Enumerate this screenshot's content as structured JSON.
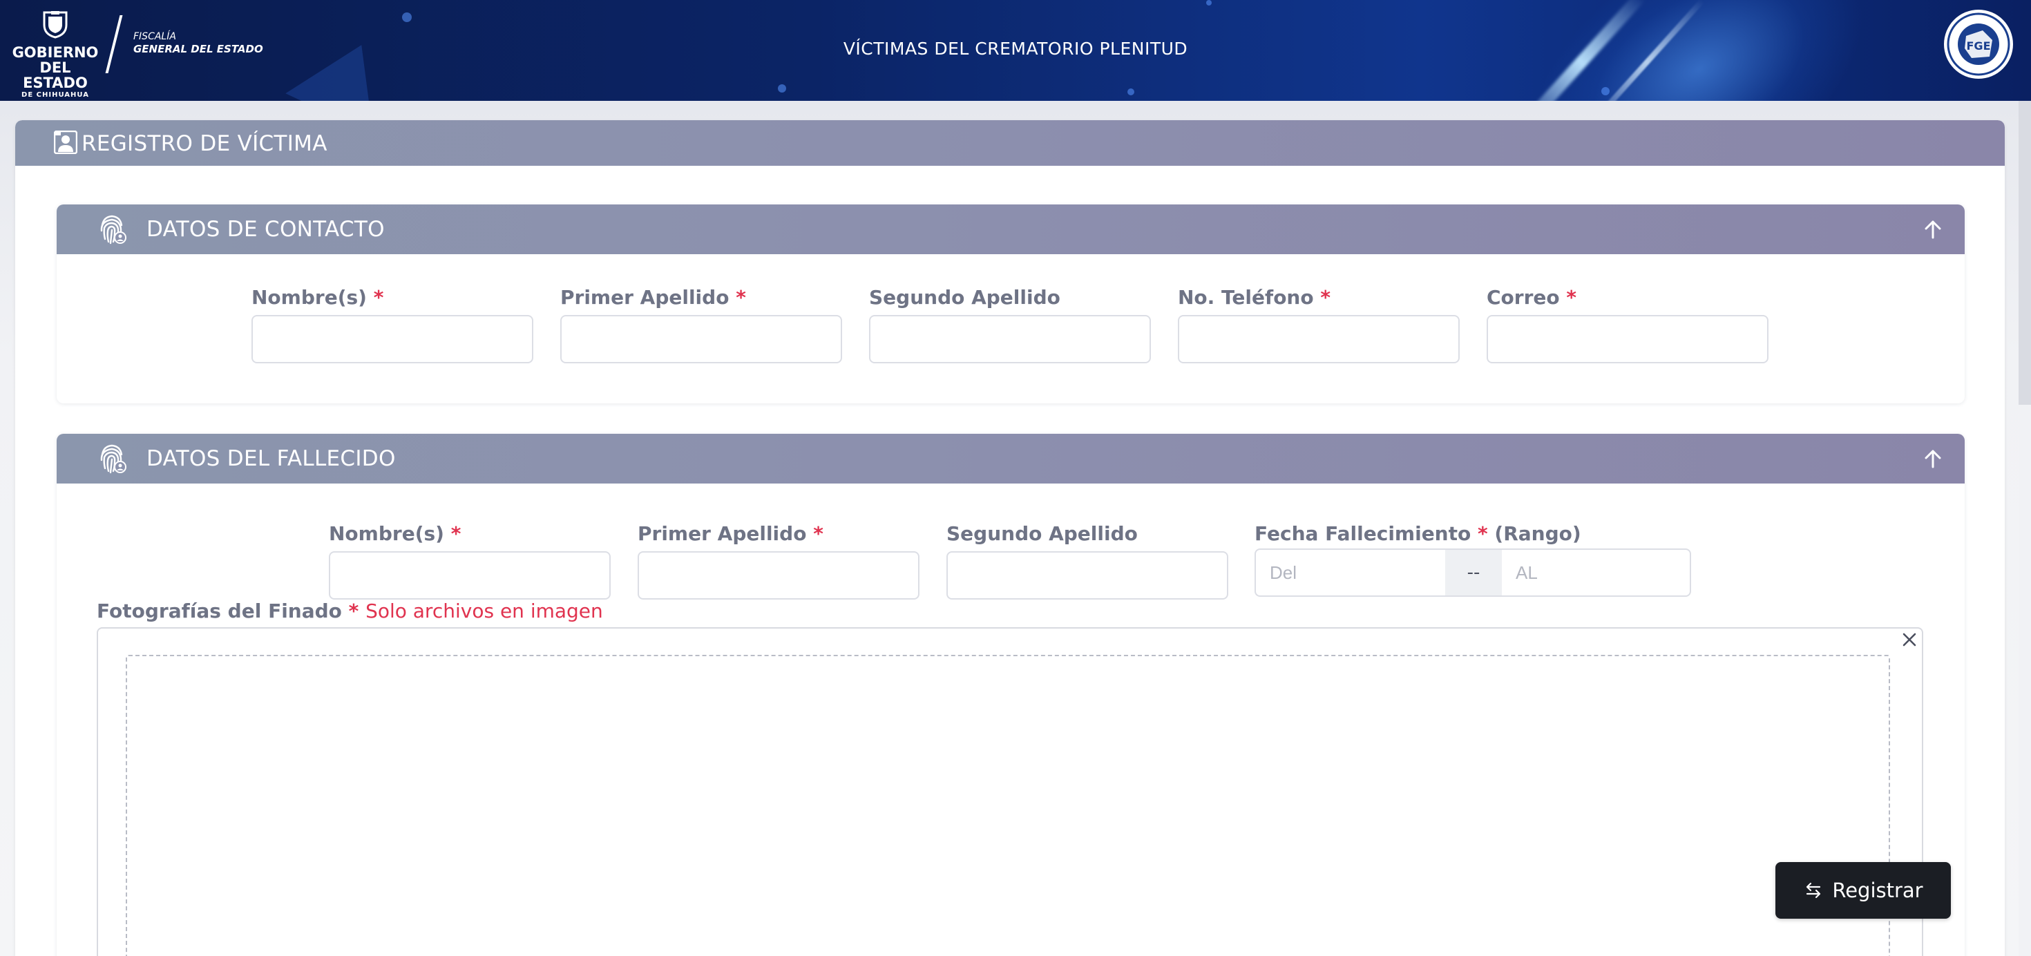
{
  "header": {
    "title": "VÍCTIMAS DEL CREMATORIO PLENITUD",
    "logo_gobierno": {
      "line1": "GOBIERNO",
      "line2": "DEL ESTADO",
      "line3": "DE CHIHUAHUA"
    },
    "logo_fiscalia": {
      "line1": "FISCALÍA",
      "line2": "GENERAL DEL ESTADO"
    },
    "seal_text": "FGE"
  },
  "main_card": {
    "title": "REGISTRO DE VÍCTIMA",
    "icon": "user-id-icon"
  },
  "contacto": {
    "title": "DATOS DE CONTACTO",
    "icon": "fingerprint-icon",
    "toggle_icon": "arrow-up-icon",
    "fields": [
      {
        "label": "Nombre(s)",
        "required": "*",
        "value": ""
      },
      {
        "label": "Primer Apellido",
        "required": "*",
        "value": ""
      },
      {
        "label": "Segundo Apellido",
        "required": "",
        "value": ""
      },
      {
        "label": "No. Teléfono",
        "required": "*",
        "value": ""
      },
      {
        "label": "Correo",
        "required": "*",
        "value": ""
      }
    ]
  },
  "fallecido": {
    "title": "DATOS DEL FALLECIDO",
    "icon": "fingerprint-icon",
    "toggle_icon": "arrow-up-icon",
    "fields": [
      {
        "label": "Nombre(s)",
        "required": "*",
        "value": ""
      },
      {
        "label": "Primer Apellido",
        "required": "*",
        "value": ""
      },
      {
        "label": "Segundo Apellido",
        "required": "",
        "value": ""
      }
    ],
    "fecha": {
      "label": "Fecha Fallecimiento",
      "required": "*",
      "suffix": "(Rango)",
      "from_placeholder": "Del",
      "separator": "--",
      "to_placeholder": "AL"
    },
    "photos": {
      "label": "Fotografías del Finado",
      "required": "*",
      "note": "Solo archivos en imagen",
      "close_icon": "close-icon"
    }
  },
  "actions": {
    "register_label": "Registrar",
    "register_icon": "swap-arrows-icon"
  },
  "colors": {
    "header_bg": "#0b2466",
    "section_header": "#8b92ad",
    "required": "#e0334f",
    "button_bg": "#1b1e24"
  }
}
